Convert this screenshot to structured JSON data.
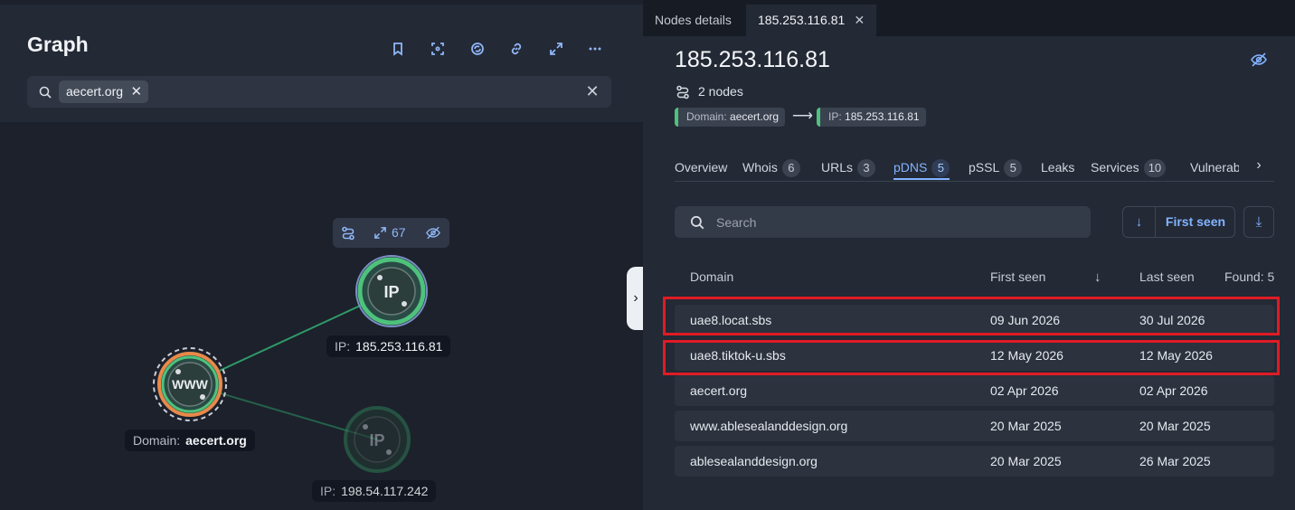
{
  "graph": {
    "title": "Graph",
    "search": {
      "chip": "aecert.org"
    },
    "node_toolbar": {
      "expand_count": "67"
    },
    "nodes": [
      {
        "id": "ip1",
        "icon_text": "IP",
        "label_key": "IP:",
        "label_value": "185.253.116.81",
        "state": "selected"
      },
      {
        "id": "domain",
        "icon_text": "WWW",
        "label_key": "Domain:",
        "label_value": "aecert.org",
        "state": "root"
      },
      {
        "id": "ip2",
        "icon_text": "IP",
        "label_key": "IP:",
        "label_value": "198.54.117.242",
        "state": "dimmed"
      }
    ]
  },
  "details": {
    "tabs": [
      "Nodes details",
      "185.253.116.81"
    ],
    "title": "185.253.116.81",
    "nodes_count": "2 nodes",
    "path": {
      "from_key": "Domain:",
      "from_value": "aecert.org",
      "to_key": "IP:",
      "to_value": "185.253.116.81"
    },
    "sections": [
      {
        "label": "Overview",
        "count": ""
      },
      {
        "label": "Whois",
        "count": "6"
      },
      {
        "label": "URLs",
        "count": "3"
      },
      {
        "label": "pDNS",
        "count": "5",
        "active": true
      },
      {
        "label": "pSSL",
        "count": "5"
      },
      {
        "label": "Leaks",
        "count": ""
      },
      {
        "label": "Services",
        "count": "10"
      },
      {
        "label": "Vulnerab",
        "count": ""
      }
    ],
    "pdns": {
      "search_placeholder": "Search",
      "sort_field": "First seen",
      "columns": {
        "domain": "Domain",
        "first_seen": "First seen",
        "last_seen": "Last seen"
      },
      "found": "Found: 5",
      "rows": [
        {
          "domain": "uae8.locat.sbs",
          "first_seen": "09 Jun 2026",
          "last_seen": "30 Jul 2026",
          "highlighted": true
        },
        {
          "domain": "uae8.tiktok-u.sbs",
          "first_seen": "12 May 2026",
          "last_seen": "12 May 2026",
          "highlighted": true
        },
        {
          "domain": "aecert.org",
          "first_seen": "02 Apr 2026",
          "last_seen": "02 Apr 2026"
        },
        {
          "domain": "www.ablesealanddesign.org",
          "first_seen": "20 Mar 2025",
          "last_seen": "20 Mar 2025"
        },
        {
          "domain": "ablesealanddesign.org",
          "first_seen": "20 Mar 2025",
          "last_seen": "26 Mar 2025"
        }
      ]
    }
  },
  "colors": {
    "accent": "#82b4ff",
    "node_green": "#4ec27c",
    "domain_orange": "#e8894a",
    "highlight_red": "#e01b24"
  }
}
